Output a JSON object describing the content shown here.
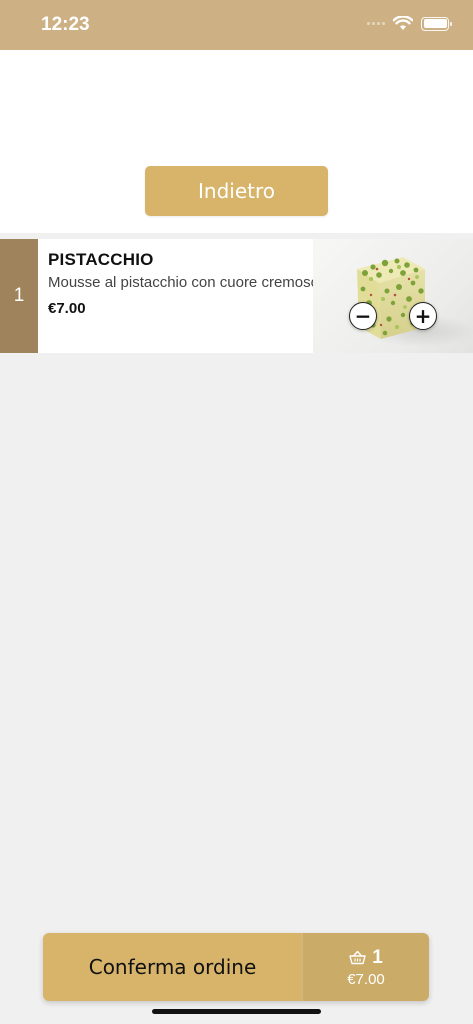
{
  "status_bar": {
    "time": "12:23",
    "battery_level": 1.0,
    "icons": [
      "cellular-signal-icon",
      "wifi-icon",
      "battery-icon"
    ]
  },
  "header": {
    "back_label": "Indietro"
  },
  "order_items": [
    {
      "quantity": "1",
      "name": "PISTACCHIO",
      "description": "Mousse al pistacchio con cuore cremoso al pistacchio",
      "price": "€7.00",
      "image": "pistachio-dessert-image",
      "decrement_icon": "minus-icon",
      "increment_icon": "plus-icon"
    }
  ],
  "footer": {
    "confirm_label": "Conferma ordine",
    "cart_count": "1",
    "cart_total": "€7.00",
    "cart_icon": "basket-icon"
  },
  "colors": {
    "status_bar": "#cdb083",
    "accent_gold": "#d7b46a",
    "cart_gold": "#cbab68",
    "quantity_strip": "#9e835d",
    "background": "#f1f0f0"
  }
}
